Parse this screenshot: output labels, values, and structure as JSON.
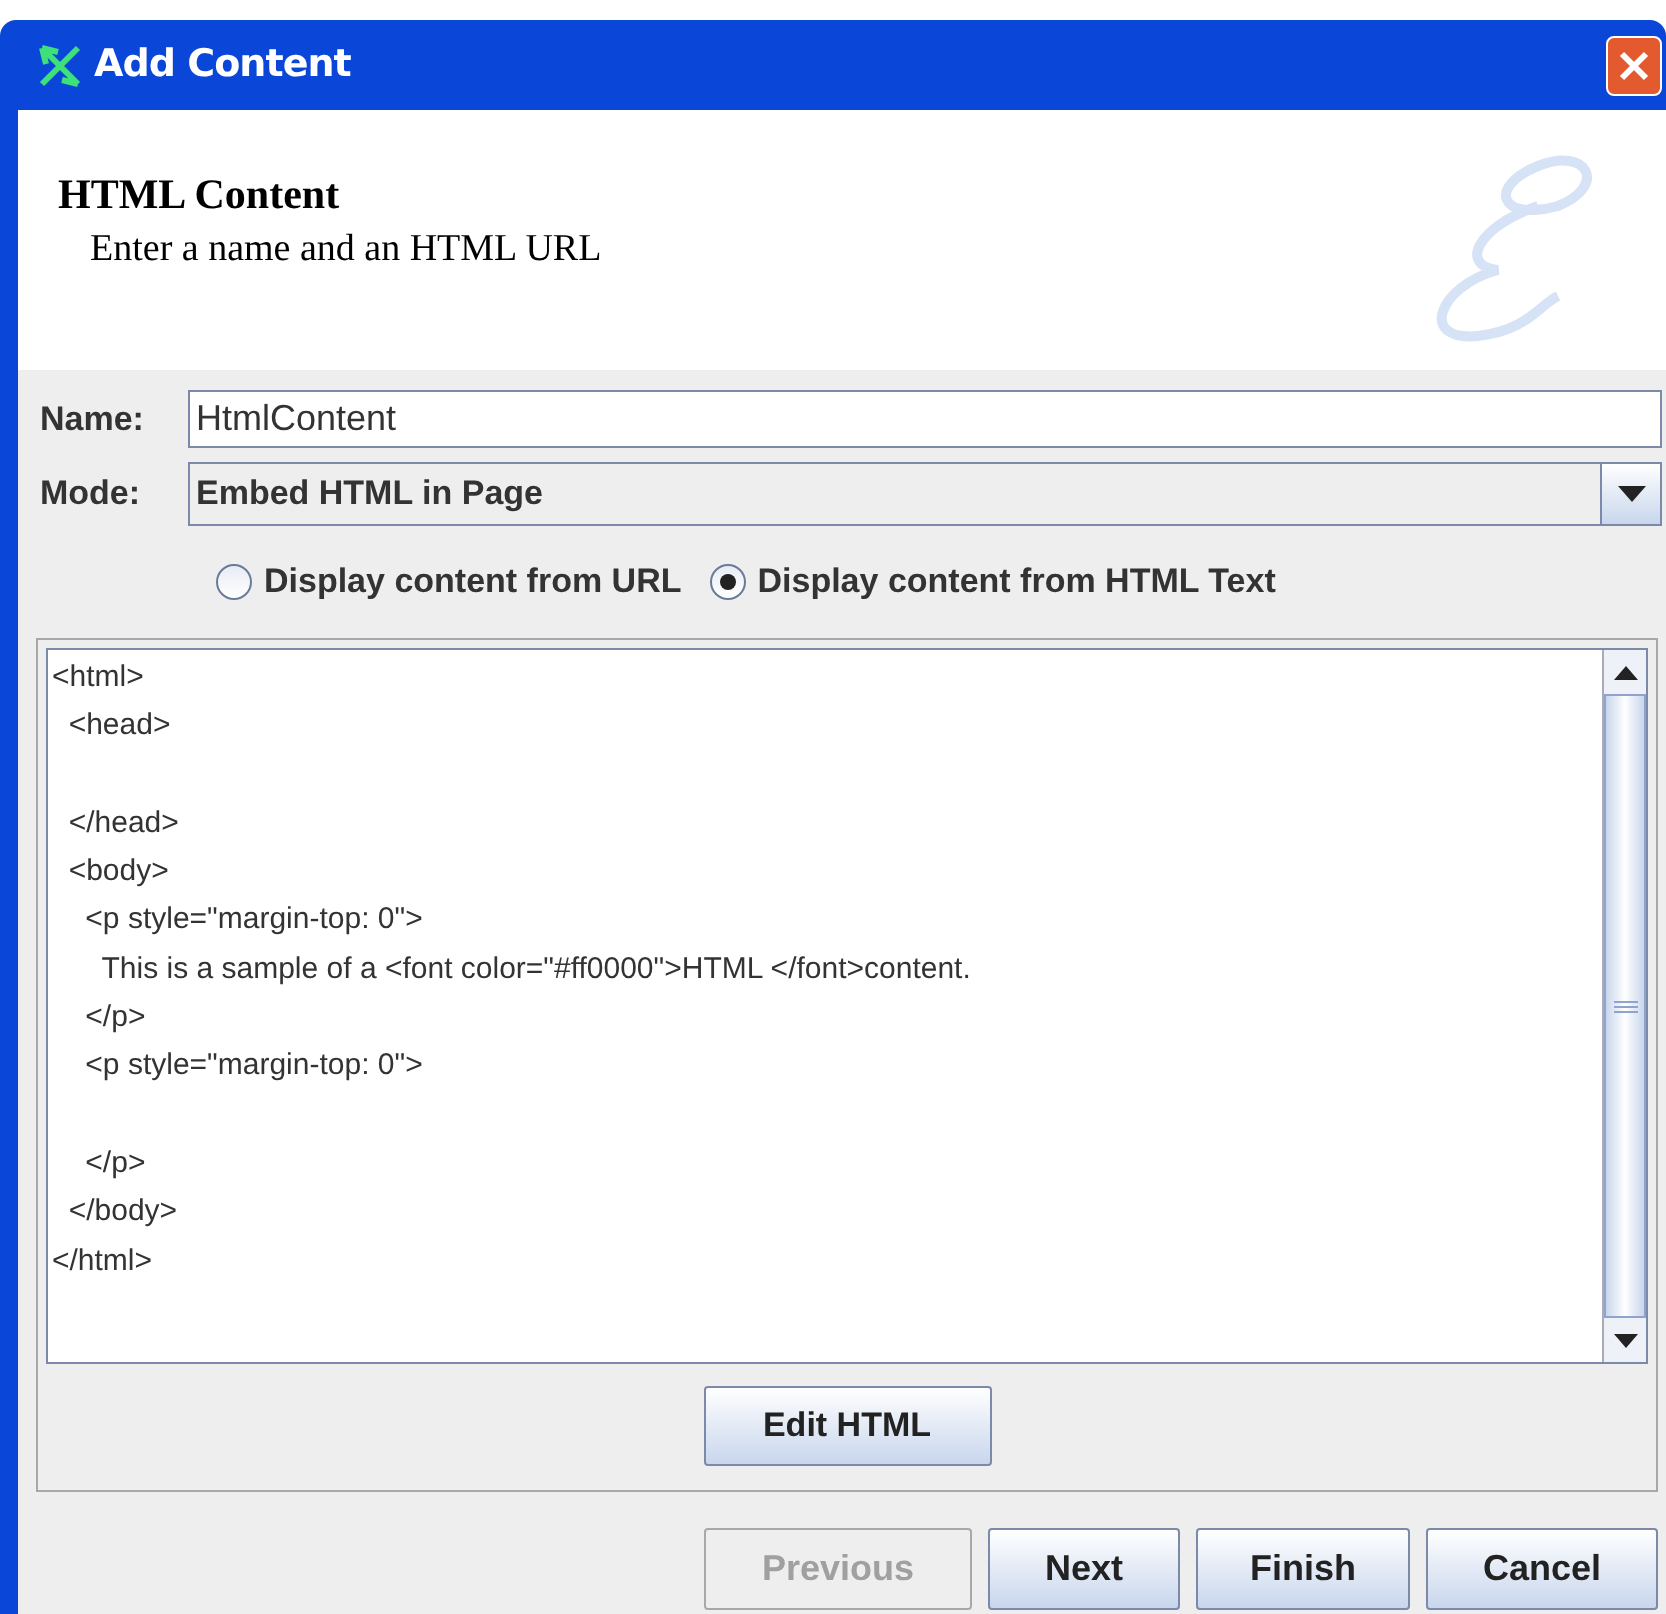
{
  "window": {
    "title": "Add Content"
  },
  "banner": {
    "title": "HTML Content",
    "subtitle": "Enter a name and an HTML URL"
  },
  "name_field": {
    "label": "Name:",
    "value": "HtmlContent"
  },
  "mode_field": {
    "label": "Mode:",
    "value": "Embed HTML in Page"
  },
  "radios": [
    {
      "label": "Display content from URL",
      "selected": false
    },
    {
      "label": "Display content from HTML Text",
      "selected": true
    }
  ],
  "editor": {
    "text": "<html>\n  <head>\n\n  </head>\n  <body>\n    <p style=\"margin-top: 0\">\n      This is a sample of a <font color=\"#ff0000\">HTML </font>content.\n    </p>\n    <p style=\"margin-top: 0\">\n\n    </p>\n  </body>\n</html>"
  },
  "edit_button": {
    "label": "Edit HTML"
  },
  "buttons": [
    {
      "label": "Previous",
      "disabled": true
    },
    {
      "label": "Next",
      "disabled": false
    },
    {
      "label": "Finish",
      "disabled": false
    },
    {
      "label": "Cancel",
      "disabled": false
    }
  ]
}
